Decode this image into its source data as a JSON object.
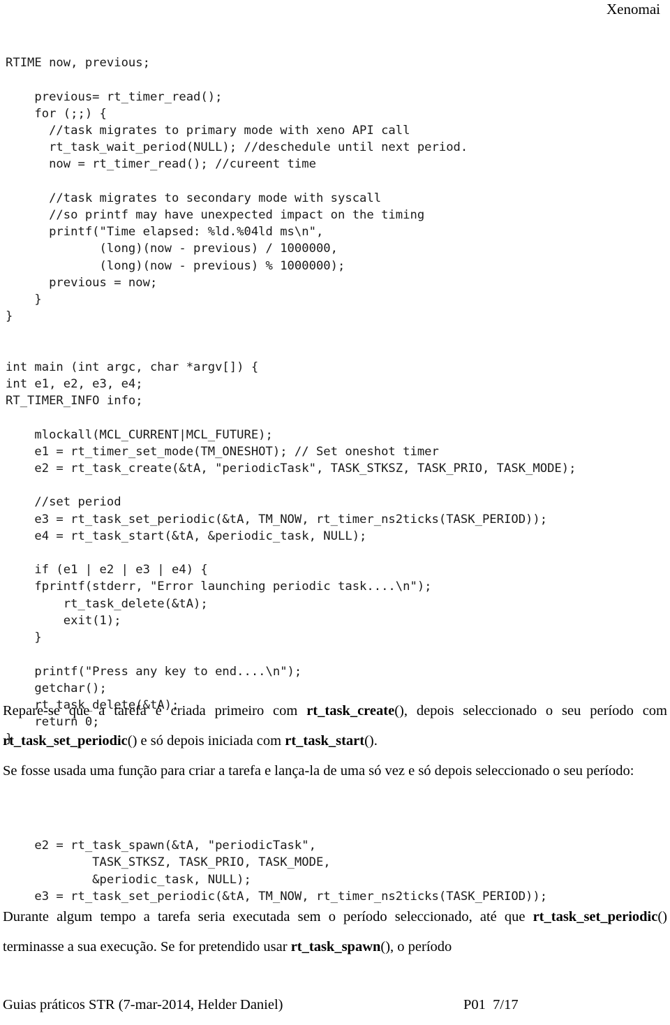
{
  "header": {
    "running_title": "Xenomai"
  },
  "code_block_1": {
    "lines": [
      "RTIME now, previous;",
      "",
      "    previous= rt_timer_read();",
      "    for (;;) {",
      "      //task migrates to primary mode with xeno API call",
      "      rt_task_wait_period(NULL); //deschedule until next period.",
      "      now = rt_timer_read(); //cureent time",
      "",
      "      //task migrates to secondary mode with syscall",
      "      //so printf may have unexpected impact on the timing",
      "      printf(\"Time elapsed: %ld.%04ld ms\\n\",",
      "             (long)(now - previous) / 1000000,",
      "             (long)(now - previous) % 1000000);",
      "      previous = now;",
      "    }",
      "}",
      "",
      "",
      "int main (int argc, char *argv[]) {",
      "int e1, e2, e3, e4;",
      "RT_TIMER_INFO info;",
      "",
      "    mlockall(MCL_CURRENT|MCL_FUTURE);",
      "    e1 = rt_timer_set_mode(TM_ONESHOT); // Set oneshot timer",
      "    e2 = rt_task_create(&tA, \"periodicTask\", TASK_STKSZ, TASK_PRIO, TASK_MODE);",
      "",
      "    //set period",
      "    e3 = rt_task_set_periodic(&tA, TM_NOW, rt_timer_ns2ticks(TASK_PERIOD));",
      "    e4 = rt_task_start(&tA, &periodic_task, NULL);",
      "",
      "    if (e1 | e2 | e3 | e4) {",
      "    fprintf(stderr, \"Error launching periodic task....\\n\");",
      "        rt_task_delete(&tA);",
      "        exit(1);",
      "    }",
      "",
      "    printf(\"Press any key to end....\\n\");",
      "    getchar();",
      "    rt_task_delete(&tA);",
      "    return 0;",
      "}"
    ]
  },
  "code_block_2": {
    "lines": [
      "    e2 = rt_task_spawn(&tA, \"periodicTask\",",
      "            TASK_STKSZ, TASK_PRIO, TASK_MODE,",
      "            &periodic_task, NULL);",
      "    e3 = rt_task_set_periodic(&tA, TM_NOW, rt_timer_ns2ticks(TASK_PERIOD));"
    ]
  },
  "paragraphs": {
    "p1": {
      "segment_1": "Repare-se que a tarefa é criada primeiro com ",
      "bold_1": "rt_task_create",
      "segment_2": "(), depois seleccionado o seu período com ",
      "bold_2": "rt_task_set_periodic",
      "segment_3": "() e só depois iniciada com ",
      "bold_3": "rt_task_start",
      "segment_4": "()."
    },
    "p2": {
      "segment_1": "Se fosse usada uma função para criar a tarefa e lança-la de uma só vez e só depois seleccionado o seu período:"
    },
    "p3": {
      "segment_1": "Durante algum tempo a tarefa seria executada sem o período seleccionado, até que ",
      "bold_1": "rt_task_set_periodic",
      "segment_2": "() terminasse a sua execução. Se for pretendido usar ",
      "bold_2": "rt_task_spawn",
      "segment_3": "(), o período"
    }
  },
  "footer": {
    "left": "Guias práticos STR (7-mar-2014, Helder Daniel)",
    "right": "P01  7/17"
  }
}
